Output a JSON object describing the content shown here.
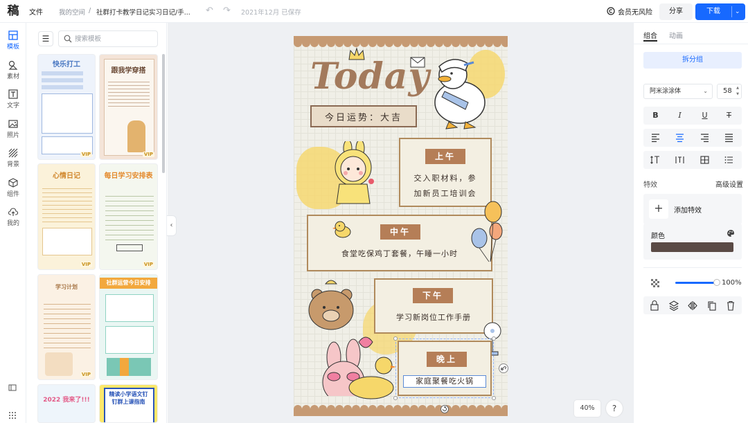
{
  "topbar": {
    "logo": "稿",
    "file_menu": "文件",
    "breadcrumb_space": "我的空间",
    "breadcrumb_sep": "/",
    "doc_title": "社群打卡教学日记实习日记/手...",
    "save_status": "2021年12月 已保存",
    "risk_label": "会员无风险",
    "share_label": "分享",
    "download_label": "下载"
  },
  "leftnav": {
    "items": [
      {
        "label": "模板"
      },
      {
        "label": "素材"
      },
      {
        "label": "文字"
      },
      {
        "label": "照片"
      },
      {
        "label": "背景"
      },
      {
        "label": "组件"
      },
      {
        "label": "我的"
      }
    ]
  },
  "templates": {
    "search_placeholder": "搜索模板",
    "vip_label": "VIP",
    "items": [
      {
        "title": "快乐打工",
        "bg": "#eef3fb",
        "accent": "#4a78c2"
      },
      {
        "title": "跟我学穿搭",
        "bg": "#f4e4d8",
        "accent": "#6b4a36"
      },
      {
        "title": "心情日记",
        "bg": "#fbf2da",
        "accent": "#d1882f"
      },
      {
        "title": "每日学习安排表",
        "bg": "#f4f7ef",
        "accent": "#e48b2e"
      },
      {
        "title": "学习计划",
        "bg": "#fbf1e4",
        "accent": "#a9794a"
      },
      {
        "title": "社群运营今日安排",
        "bg": "#eaf6f3",
        "accent": "#f2a83d"
      },
      {
        "title": "2022 我来了!!!",
        "bg": "#eef5fb",
        "accent": "#e35b88"
      },
      {
        "title": "精读小学语文钉钉群上课指南",
        "bg": "#fde86b",
        "accent": "#2a55b8"
      }
    ]
  },
  "poster": {
    "title": "Today",
    "fortune": "今日运势：大吉",
    "sections": [
      {
        "tag": "上午",
        "text1": "交入职材料，参",
        "text2": "加新员工培训会"
      },
      {
        "tag": "中午",
        "text1": "食堂吃保鸡丁套餐，午睡一小时",
        "text2": ""
      },
      {
        "tag": "下午",
        "text1": "学习新岗位工作手册",
        "text2": ""
      },
      {
        "tag": "晚上",
        "text1": "家庭聚餐吃火锅",
        "text2": ""
      }
    ],
    "colors": {
      "brown": "#b57e57",
      "cream": "#f0efe7",
      "yellow": "#f6d76a"
    }
  },
  "canvas": {
    "zoom": "40%",
    "help": "?"
  },
  "rightpanel": {
    "tab_group": "组合",
    "tab_anim": "动画",
    "ungroup": "拆分组",
    "font_name": "阿米涂涂体",
    "font_size": "58",
    "text_buttons": [
      "B",
      "I",
      "U",
      "T"
    ],
    "fx_title": "特效",
    "fx_adv": "高级设置",
    "fx_add": "添加特效",
    "color_label": "颜色",
    "color_value": "#5a4a45",
    "opacity_value": "100%",
    "opacity_level": 1.0
  }
}
